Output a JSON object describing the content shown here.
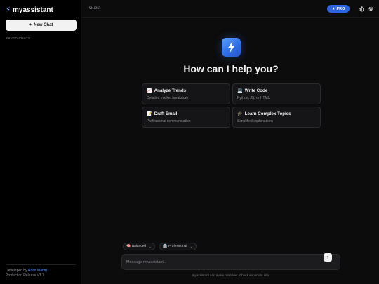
{
  "sidebar": {
    "brand": "myassistant",
    "new_chat_label": "New Chat",
    "saved_chats_label": "SAVED CHATS",
    "footer": {
      "developed_by": "Developed by",
      "developer_name": "Rohit Mantri",
      "version": "Production Release v3.1"
    }
  },
  "topbar": {
    "user": "Guest",
    "pro_label": "PRO"
  },
  "main": {
    "title": "How can I help you?",
    "suggestions": [
      {
        "emoji": "📈",
        "title": "Analyze Trends",
        "subtitle": "Detailed market breakdown"
      },
      {
        "emoji": "💻",
        "title": "Write Code",
        "subtitle": "Python, JS, or HTML"
      },
      {
        "emoji": "📝",
        "title": "Draft Email",
        "subtitle": "Professional communication"
      },
      {
        "emoji": "🎓",
        "title": "Learn Complex Topics",
        "subtitle": "Simplified explanations"
      }
    ]
  },
  "composer": {
    "mode_label": "Balanced",
    "tone_label": "Professional",
    "placeholder": "Message myassistant...",
    "value": "",
    "disclaimer": "myassistant can make mistakes. Check important info."
  },
  "colors": {
    "accent": "#2b63e0",
    "background": "#0c0c0d",
    "sidebar": "#000000"
  },
  "icons": {
    "brand": "lightning-bolt-icon",
    "new_chat": "plus-icon",
    "pro": "star-icon",
    "bug": "bug-icon",
    "settings": "gear-icon",
    "send": "arrow-up-icon",
    "mode": "brain-icon",
    "tone": "briefcase-icon"
  }
}
